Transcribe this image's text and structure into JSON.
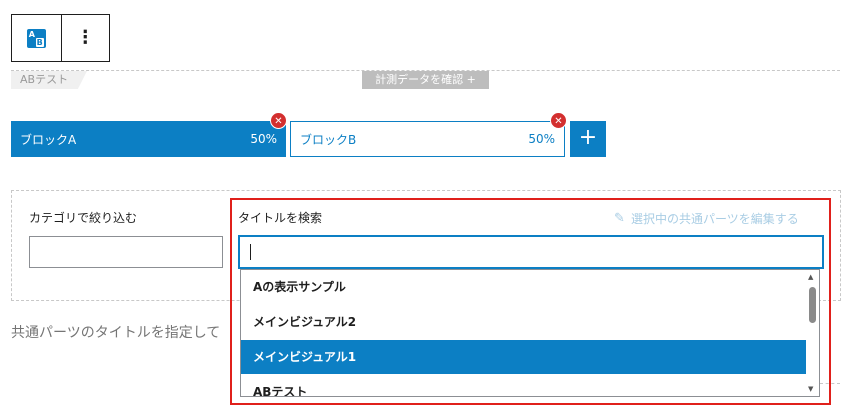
{
  "toolbar": {
    "more_label": "⋮",
    "ab_icon_a": "A",
    "ab_icon_b": "B"
  },
  "ab_tag": "ABテスト",
  "confirm_tag": "計測データを確認 +",
  "blocks": [
    {
      "name": "ブロックA",
      "percent": "50%",
      "active": true
    },
    {
      "name": "ブロックB",
      "percent": "50%",
      "active": false
    }
  ],
  "remove_symbol": "✕",
  "add_symbol": "+",
  "category_filter": {
    "label": "カテゴリで絞り込む",
    "value": ""
  },
  "title_search": {
    "label": "タイトルを検索",
    "value": ""
  },
  "edit_link": "選択中の共通パーツを編集する",
  "help_text": "共通パーツのタイトルを指定して",
  "dropdown": {
    "options": [
      "Aの表示サンプル",
      "メインビジュアル2",
      "メインビジュアル1",
      "ABテスト"
    ],
    "selected_index": 2
  },
  "colors": {
    "accent": "#0c7fc4",
    "remove": "#d32f2f",
    "highlight_frame": "#e0201b"
  }
}
